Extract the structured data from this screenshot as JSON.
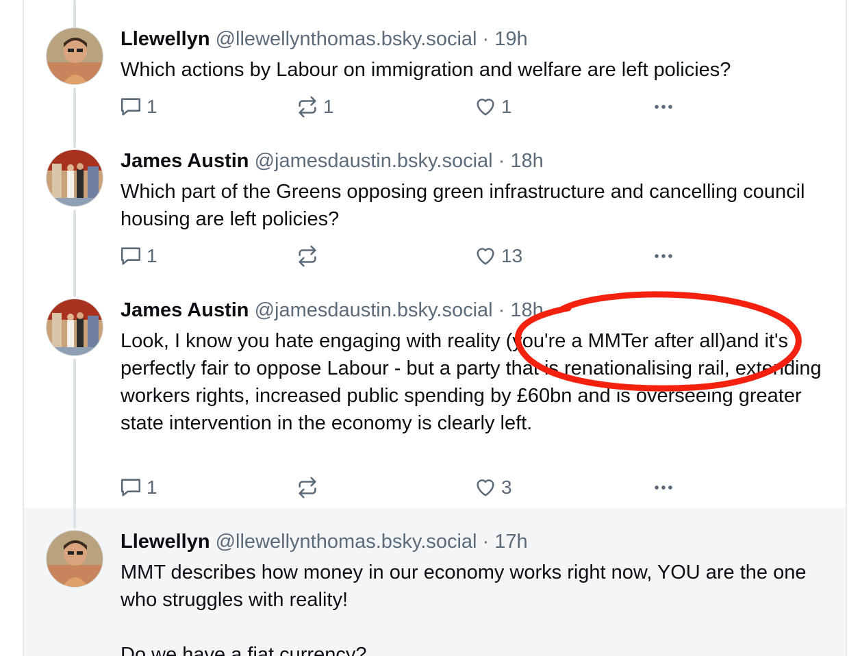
{
  "posts": [
    {
      "author": "Llewellyn",
      "handle": "@llewellynthomas.bsky.social",
      "separator": "·",
      "time": "19h",
      "text": "Which actions by Labour on immigration and welfare are left policies?",
      "replies": "1",
      "reposts": "1",
      "likes": "1",
      "avatar": "llewellyn-avatar"
    },
    {
      "author": "James Austin",
      "handle": "@jamesdaustin.bsky.social",
      "separator": "·",
      "time": "18h",
      "text": "Which part of the Greens opposing green infrastructure and cancelling council housing are left policies?",
      "replies": "1",
      "reposts": "",
      "likes": "13",
      "avatar": "james-avatar"
    },
    {
      "author": "James Austin",
      "handle": "@jamesdaustin.bsky.social",
      "separator": "·",
      "time": "18h",
      "text": "Look, I know you hate engaging with reality (you're a MMTer after all)and it's perfectly fair to oppose Labour - but a party that is renationalising rail, extending workers rights, increased public spending by £60bn and is overseeing greater state intervention in the economy is clearly left.",
      "replies": "1",
      "reposts": "",
      "likes": "3",
      "avatar": "james-avatar"
    },
    {
      "author": "Llewellyn",
      "handle": "@llewellynthomas.bsky.social",
      "separator": "·",
      "time": "17h",
      "text": "MMT describes how money in our economy works right now, YOU are the one who struggles with reality!\n\nDo we have a fiat currency?",
      "avatar": "llewellyn-avatar"
    }
  ],
  "colors": {
    "text": "#0b0f14",
    "muted": "#5b6b7a",
    "thread_line": "#dde2e7",
    "focused_bg": "#f4f5f6",
    "annotation": "#f5210f"
  },
  "icons": [
    "reply-icon",
    "repost-icon",
    "like-icon",
    "more-icon"
  ]
}
